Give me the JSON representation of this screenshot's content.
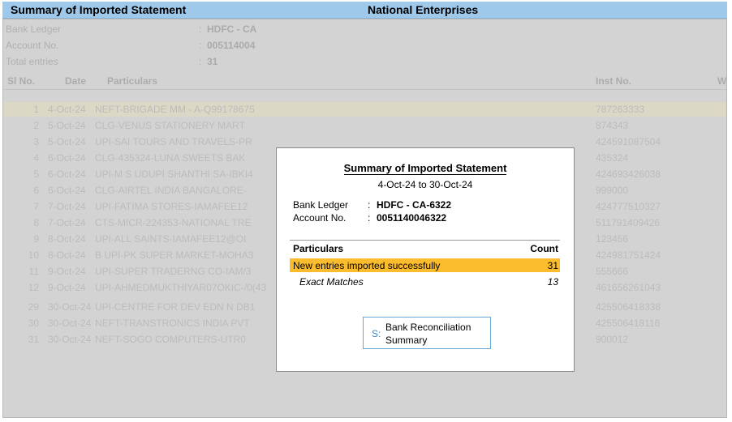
{
  "title_bar": {
    "screen_title": "Summary of Imported Statement",
    "company_name": "National Enterprises"
  },
  "background": {
    "info": [
      {
        "label": "Bank Ledger",
        "value": "HDFC - CA"
      },
      {
        "label": "Account No.",
        "value": "005114004"
      },
      {
        "label": "Total entries",
        "value": "31"
      }
    ],
    "columns": {
      "sl_no": "Sl No.",
      "date": "Date",
      "particulars": "Particulars",
      "inst_no": "Inst No.",
      "extra": "W"
    },
    "rows": [
      {
        "sl": "1",
        "date": "4-Oct-24",
        "particulars": "NEFT-BRIGADE MM - A-Q99178675",
        "inst": "787263333"
      },
      {
        "sl": "2",
        "date": "5-Oct-24",
        "particulars": "CLG-VENUS STATIONERY MART",
        "inst": "874343"
      },
      {
        "sl": "3",
        "date": "5-Oct-24",
        "particulars": "UPI-SAI TOURS AND TRAVELS-PR",
        "inst": "424591087504"
      },
      {
        "sl": "4",
        "date": "6-Oct-24",
        "particulars": "CLG-435324-LUNA SWEETS BAK",
        "inst": "435324"
      },
      {
        "sl": "5",
        "date": "6-Oct-24",
        "particulars": "UPI-M S UDUPI SHANTHI SA-IBKI4",
        "inst": "424693426038"
      },
      {
        "sl": "6",
        "date": "6-Oct-24",
        "particulars": "CLG-AIRTEL INDIA BANGALORE-",
        "inst": "999000"
      },
      {
        "sl": "7",
        "date": "7-Oct-24",
        "particulars": "UPI-FATIMA STORES-IAMAFEE12",
        "inst": "424777510327"
      },
      {
        "sl": "8",
        "date": "7-Oct-24",
        "particulars": "CTS-MICR-224353-NATIONAL TRE",
        "inst": "511791409426"
      },
      {
        "sl": "9",
        "date": "8-Oct-24",
        "particulars": "UPI-ALL SAINTS-IAMAFEE12@OI",
        "inst": "123456"
      },
      {
        "sl": "10",
        "date": "8-Oct-24",
        "particulars": "B UPI-PK SUPER MARKET-MOHA3",
        "inst": "424981751424"
      },
      {
        "sl": "11",
        "date": "9-Oct-24",
        "particulars": "UPI-SUPER TRADERNG CO-IAM/3",
        "inst": "555666"
      },
      {
        "sl": "12",
        "date": "9-Oct-24",
        "particulars": "UPI-AHMEDMUKTHIYAR07OKIC-/0(43",
        "inst": "461656261043"
      },
      {
        "sl": "29",
        "date": "30-Oct-24",
        "particulars": "UPI-CENTRE FOR DEV EDN N DB1",
        "inst": "425506418338"
      },
      {
        "sl": "30",
        "date": "30-Oct-24",
        "particulars": "NEFT-TRANSTRONICS INDIA PVT",
        "inst": "425506418116"
      },
      {
        "sl": "31",
        "date": "30-Oct-24",
        "particulars": "NEFT-SOGO COMPUTERS-UTR0",
        "inst": "900012"
      }
    ]
  },
  "dialog": {
    "title": "Summary of Imported Statement",
    "date_range": "4-Oct-24 to 30-Oct-24",
    "bank_ledger_label": "Bank Ledger",
    "bank_ledger_value": "HDFC - CA-6322",
    "account_no_label": "Account No.",
    "account_no_value": "0051140046322",
    "colon": ":",
    "table": {
      "header_particulars": "Particulars",
      "header_count": "Count",
      "rows": [
        {
          "label": "New entries imported successfully",
          "count": "31"
        },
        {
          "label": "Exact Matches",
          "count": "13"
        }
      ]
    },
    "button": {
      "shortcut": "S:",
      "label_line1": "Bank Reconciliation",
      "label_line2": "Summary"
    }
  },
  "colors": {
    "title_bar": "#9fc9ea",
    "selected_row": "#fbbd2e",
    "button_border": "#6aa7d4"
  }
}
